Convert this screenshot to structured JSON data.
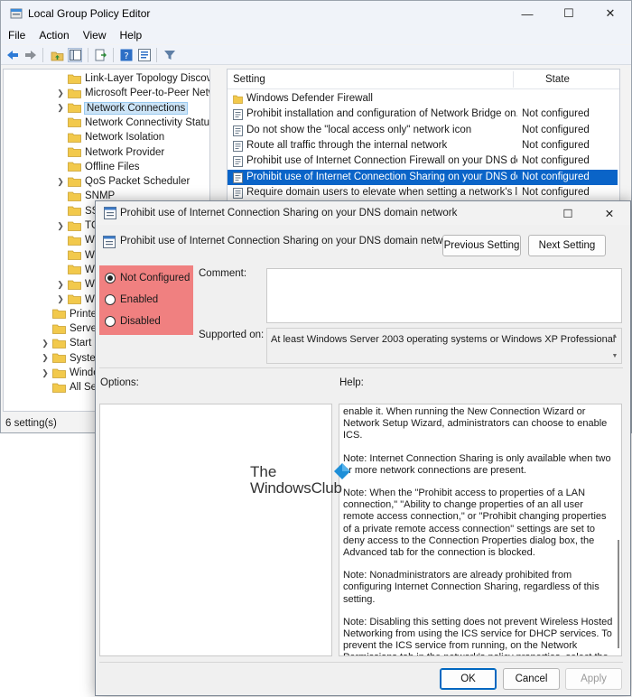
{
  "main_window": {
    "title": "Local Group Policy Editor",
    "controls": {
      "minimize": "—",
      "maximize": "☐",
      "close": "✕"
    },
    "menu": [
      "File",
      "Action",
      "View",
      "Help"
    ],
    "toolbar_icons": [
      "back-arrow-icon",
      "forward-arrow-icon",
      "up-folder-icon",
      "show-hide-tree-icon",
      "export-list-icon",
      "help-icon",
      "properties-icon",
      "filter-icon"
    ],
    "tree": [
      {
        "label": "Link-Layer Topology Discove",
        "expandable": false
      },
      {
        "label": "Microsoft Peer-to-Peer Netw",
        "expandable": true
      },
      {
        "label": "Network Connections",
        "expandable": true,
        "selected": true
      },
      {
        "label": "Network Connectivity Status",
        "expandable": false
      },
      {
        "label": "Network Isolation",
        "expandable": false
      },
      {
        "label": "Network Provider",
        "expandable": false
      },
      {
        "label": "Offline Files",
        "expandable": false
      },
      {
        "label": "QoS Packet Scheduler",
        "expandable": true
      },
      {
        "label": "SNMP",
        "expandable": false
      },
      {
        "label": "SS",
        "expandable": false
      },
      {
        "label": "TC",
        "expandable": true
      },
      {
        "label": "Wi",
        "expandable": false
      },
      {
        "label": "Wi",
        "expandable": false
      },
      {
        "label": "Wi",
        "expandable": false
      },
      {
        "label": "WI",
        "expandable": true
      },
      {
        "label": "W",
        "expandable": true
      },
      {
        "label": "Printe",
        "expandable": false,
        "level": 1
      },
      {
        "label": "Server",
        "expandable": false,
        "level": 1
      },
      {
        "label": "Start M",
        "expandable": true,
        "level": 1
      },
      {
        "label": "System",
        "expandable": true,
        "level": 1
      },
      {
        "label": "Windo",
        "expandable": true,
        "level": 1
      },
      {
        "label": "All Set",
        "expandable": false,
        "level": 1
      }
    ],
    "list": {
      "col_setting": "Setting",
      "col_state": "State",
      "rows": [
        {
          "name": "Windows Defender Firewall",
          "state": "",
          "type": "folder"
        },
        {
          "name": "Prohibit installation and configuration of Network Bridge on...",
          "state": "Not configured",
          "type": "policy"
        },
        {
          "name": "Do not show the \"local access only\" network icon",
          "state": "Not configured",
          "type": "policy"
        },
        {
          "name": "Route all traffic through the internal network",
          "state": "Not configured",
          "type": "policy"
        },
        {
          "name": "Prohibit use of Internet Connection Firewall on your DNS do...",
          "state": "Not configured",
          "type": "policy"
        },
        {
          "name": "Prohibit use of Internet Connection Sharing on your DNS do...",
          "state": "Not configured",
          "type": "policy",
          "selected": true
        },
        {
          "name": "Require domain users to elevate when setting a network's lo...",
          "state": "Not configured",
          "type": "policy"
        }
      ]
    },
    "status": "6 setting(s)"
  },
  "dialog": {
    "title": "Prohibit use of Internet Connection Sharing on your DNS domain network",
    "header": "Prohibit use of Internet Connection Sharing on your DNS domain network",
    "controls": {
      "maximize": "☐",
      "close": "✕"
    },
    "prev_button": "Previous Setting",
    "next_button": "Next Setting",
    "radios": {
      "not_configured": "Not Configured",
      "enabled": "Enabled",
      "disabled": "Disabled",
      "selected": "not_configured"
    },
    "comment_label": "Comment:",
    "comment_value": "",
    "supported_label": "Supported on:",
    "supported_value": "At least Windows Server 2003 operating systems or Windows XP Professional",
    "options_label": "Options:",
    "help_label": "Help:",
    "help_paragraphs": [
      "enable it. When running the New Connection Wizard or Network Setup Wizard, administrators can choose to enable ICS.",
      "Note: Internet Connection Sharing is only available when two or more network connections are present.",
      "Note: When the \"Prohibit access to properties of a LAN connection,\" \"Ability to change properties of an all user remote access connection,\" or \"Prohibit changing properties of a private remote access connection\" settings are set to deny access to the Connection Properties dialog box, the Advanced tab for the connection is blocked.",
      "Note: Nonadministrators are already prohibited from configuring Internet Connection Sharing, regardless of this setting.",
      "Note: Disabling this setting does not prevent Wireless Hosted Networking from using the ICS service for DHCP services. To prevent the ICS service from running, on the Network Permissions tab in the network's policy properties, select the \"Don't use hosted networks\" check box."
    ],
    "ok_button": "OK",
    "cancel_button": "Cancel",
    "apply_button": "Apply",
    "radio_highlight_color": "#f08080"
  },
  "watermark": {
    "line1": "The",
    "line2": "WindowsClub"
  }
}
